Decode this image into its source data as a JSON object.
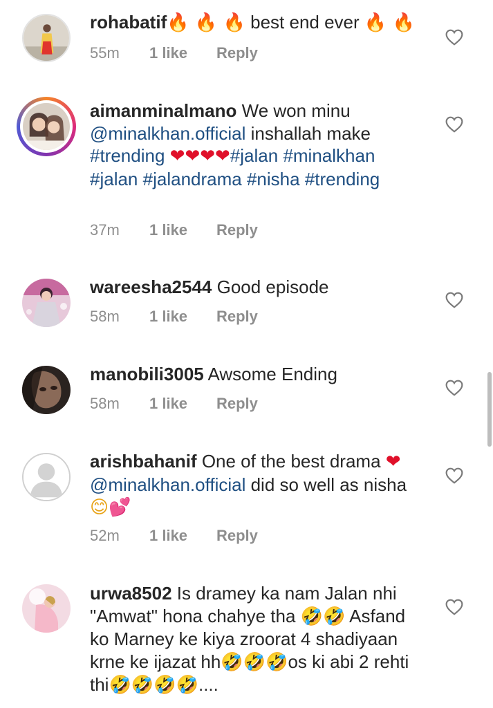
{
  "comments": [
    {
      "username": "rohabatif",
      "parts": [
        {
          "t": "emoji",
          "v": "🔥 🔥 🔥",
          "c": "fire"
        },
        {
          "t": "text",
          "v": " best end ever "
        },
        {
          "t": "emoji",
          "v": "🔥 🔥",
          "c": "fire"
        }
      ],
      "time": "55m",
      "likes": "1 like",
      "reply": "Reply",
      "avatar": "profile-photo"
    },
    {
      "username": "aimanminalmano",
      "parts": [
        {
          "t": "text",
          "v": " We won minu "
        },
        {
          "t": "link",
          "v": "@minalkhan.official"
        },
        {
          "t": "text",
          "v": " inshallah make "
        },
        {
          "t": "link",
          "v": "#trending"
        },
        {
          "t": "text",
          "v": " "
        },
        {
          "t": "emoji",
          "v": "❤❤❤❤",
          "c": "heart"
        },
        {
          "t": "link",
          "v": "#jalan"
        },
        {
          "t": "text",
          "v": " "
        },
        {
          "t": "link",
          "v": "#minalkhan"
        },
        {
          "t": "text",
          "v": " "
        },
        {
          "t": "link",
          "v": "#jalan"
        },
        {
          "t": "text",
          "v": " "
        },
        {
          "t": "link",
          "v": "#jalandrama"
        },
        {
          "t": "text",
          "v": " "
        },
        {
          "t": "link",
          "v": "#nisha"
        },
        {
          "t": "text",
          "v": " "
        },
        {
          "t": "link",
          "v": "#trending"
        }
      ],
      "time": "37m",
      "likes": "1 like",
      "reply": "Reply",
      "avatar": "story-ring-photo"
    },
    {
      "username": "wareesha2544",
      "parts": [
        {
          "t": "text",
          "v": " Good episode"
        }
      ],
      "time": "58m",
      "likes": "1 like",
      "reply": "Reply",
      "avatar": "profile-photo"
    },
    {
      "username": "manobili3005",
      "parts": [
        {
          "t": "text",
          "v": " Awsome Ending"
        }
      ],
      "time": "58m",
      "likes": "1 like",
      "reply": "Reply",
      "avatar": "profile-photo"
    },
    {
      "username": "arishbahanif",
      "parts": [
        {
          "t": "text",
          "v": " One of the best drama "
        },
        {
          "t": "emoji",
          "v": "❤",
          "c": "heart"
        },
        {
          "t": "text",
          "v": "  "
        },
        {
          "t": "link",
          "v": "@minalkhan.official"
        },
        {
          "t": "text",
          "v": "  did so well as nisha "
        },
        {
          "t": "emoji",
          "v": "😊",
          "c": "smile"
        },
        {
          "t": "emoji",
          "v": "💕",
          "c": "hearts2"
        }
      ],
      "time": "52m",
      "likes": "1 like",
      "reply": "Reply",
      "avatar": "default-avatar"
    },
    {
      "username": "urwa8502",
      "parts": [
        {
          "t": "text",
          "v": " Is dramey ka nam Jalan nhi \"Amwat\" hona chahye tha "
        },
        {
          "t": "emoji",
          "v": "🤣🤣",
          "c": "laugh"
        },
        {
          "t": "text",
          "v": " Asfand ko Marney ke kiya zroorat 4 shadiyaan krne ke ijazat hh"
        },
        {
          "t": "emoji",
          "v": "🤣🤣🤣",
          "c": "laugh"
        },
        {
          "t": "text",
          "v": "os ki abi 2 rehti thi"
        },
        {
          "t": "emoji",
          "v": "🤣🤣🤣🤣",
          "c": "laugh"
        },
        {
          "t": "text",
          "v": "...."
        }
      ],
      "time": "",
      "likes": "",
      "reply": "",
      "avatar": "profile-photo"
    }
  ],
  "icons": {
    "like": "heart-outline-icon"
  },
  "colors": {
    "text": "#262626",
    "link": "#1f4f82",
    "meta": "#8e8e8e"
  }
}
